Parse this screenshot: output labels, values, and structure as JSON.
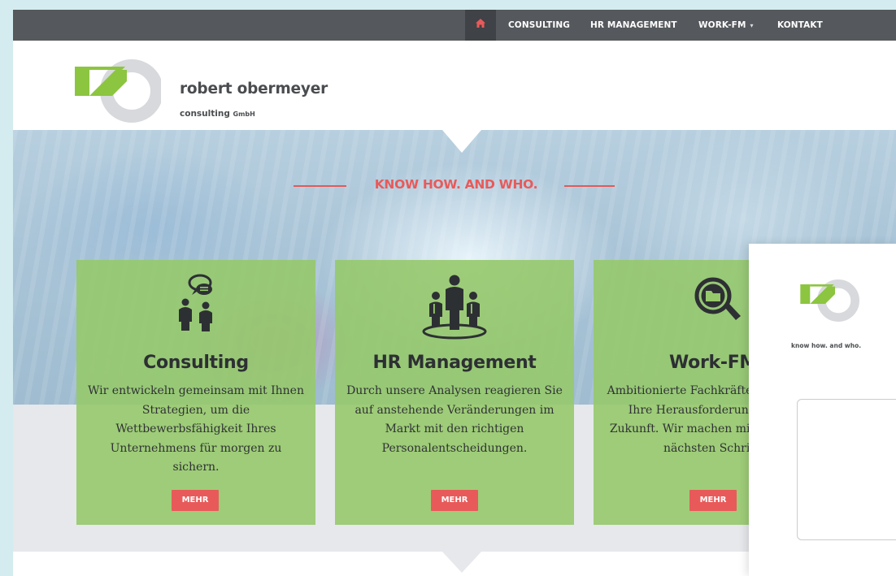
{
  "nav": {
    "home_icon": "home-icon",
    "items": [
      {
        "label": "CONSULTING"
      },
      {
        "label": "HR MANAGEMENT"
      },
      {
        "label": "WORK-FM",
        "caret": "▾"
      },
      {
        "label": "KONTAKT"
      }
    ]
  },
  "brand": {
    "name": "robert obermeyer",
    "sub": "consulting",
    "sub_suffix": "GmbH"
  },
  "hero": {
    "tagline": "KNOW HOW. AND WHO."
  },
  "cards": [
    {
      "icon": "consulting-people-speech-icon",
      "title": "Consulting",
      "text": "Wir entwickeln gemeinsam mit Ihnen Strategien, um die Wettbewerbsfähigkeit Ihres Unternehmens für morgen zu sichern.",
      "button": "MEHR"
    },
    {
      "icon": "hr-team-icon",
      "title": "HR Management",
      "text": "Durch unsere Analysen reagieren Sie auf anstehende Veränderungen im Markt mit den richtigen Personalentscheidungen.",
      "button": "MEHR"
    },
    {
      "icon": "magnifier-folder-icon",
      "title": "Work-FM",
      "text": "Ambitionierte Fachkräfte finden hier Ihre Herausforderung für die Zukunft. Wir machen mit Ihnen den nächsten Schritt.",
      "button": "MEHR"
    }
  ],
  "panel": {
    "tagline": "know how. and who."
  },
  "colors": {
    "nav_bg": "#55585c",
    "accent_red": "#e85a5a",
    "logo_green": "#8cc540",
    "card_green": "#96c96b",
    "logo_gray": "#d7d9dc"
  }
}
